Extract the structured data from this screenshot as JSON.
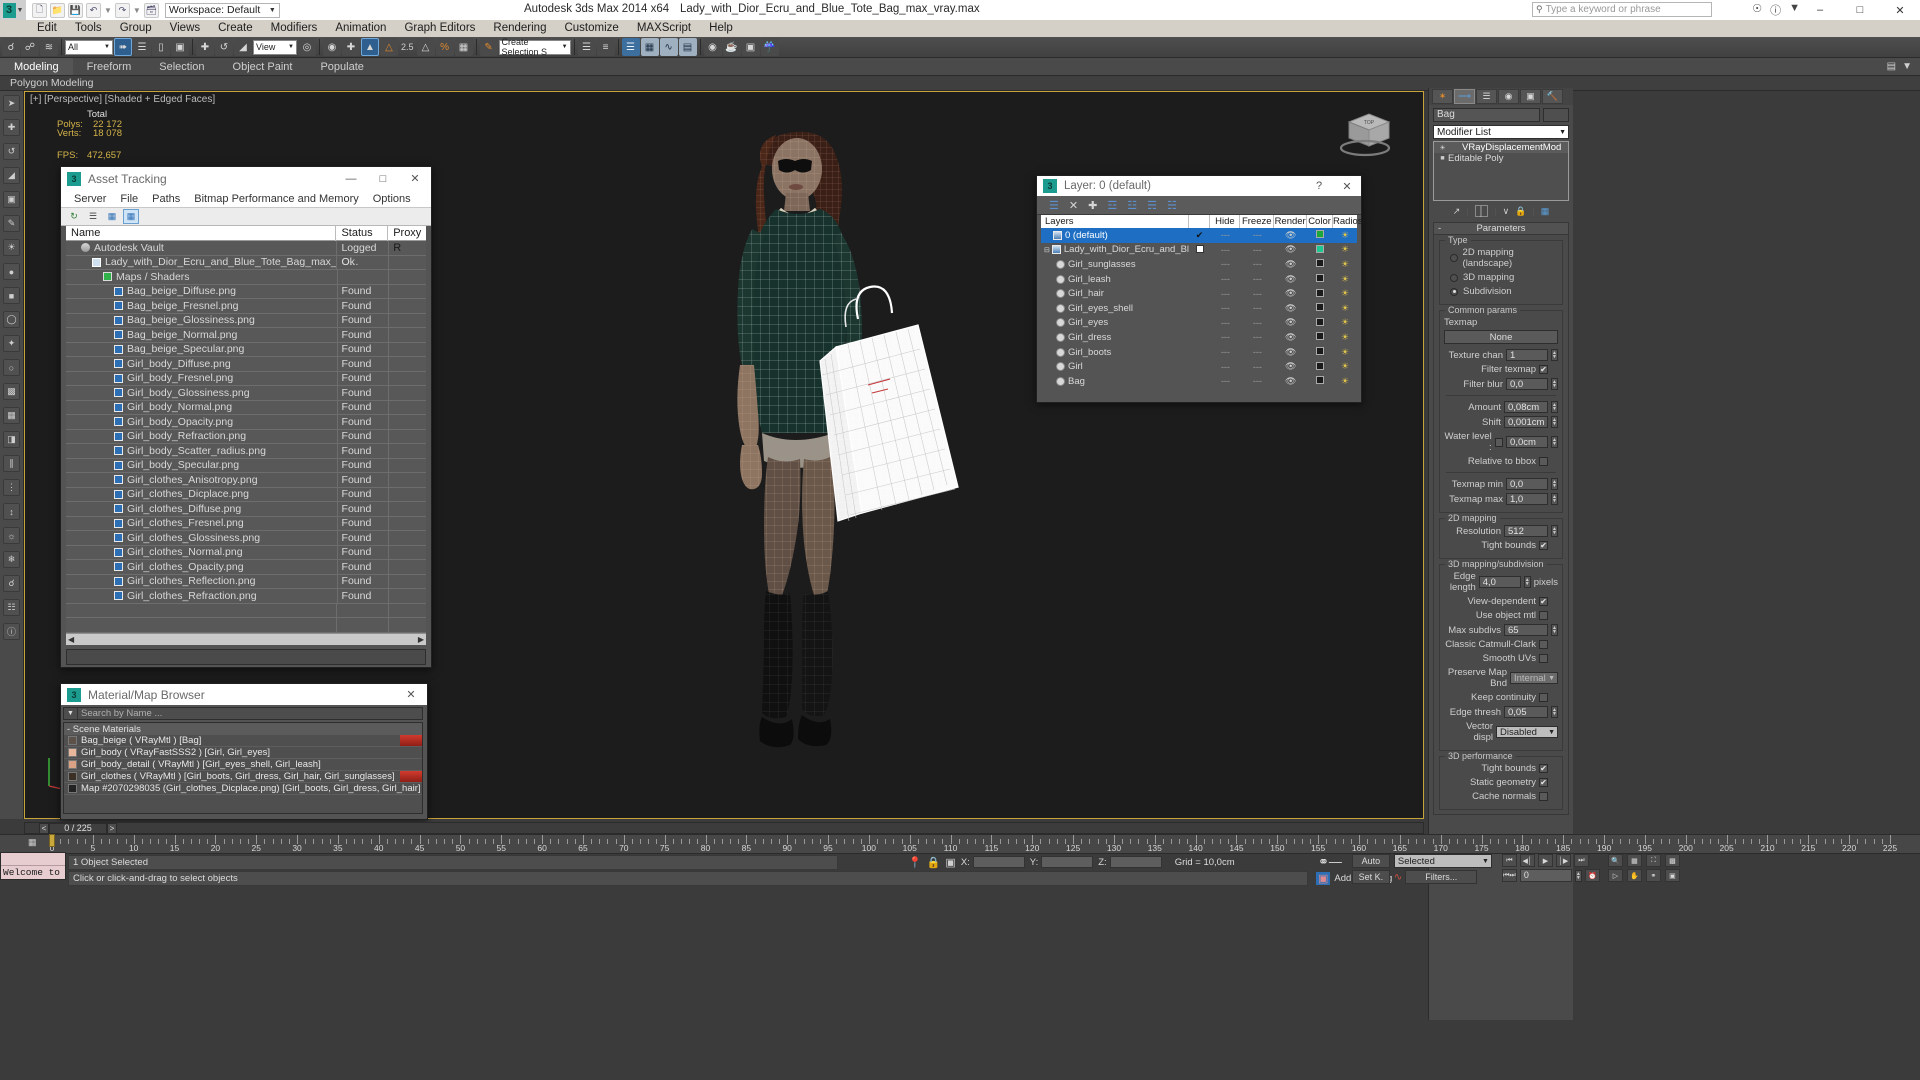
{
  "titlebar": {
    "app_icon": "max-logo-icon",
    "workspace_label": "Workspace: Default",
    "product": "Autodesk 3ds Max  2014 x64",
    "filename": "Lady_with_Dior_Ecru_and_Blue_Tote_Bag_max_vray.max",
    "search_placeholder": "Type a keyword or phrase",
    "minimize": "–",
    "maximize": "□",
    "close": "✕"
  },
  "menubar": {
    "items": [
      "Edit",
      "Tools",
      "Group",
      "Views",
      "Create",
      "Modifiers",
      "Animation",
      "Graph Editors",
      "Rendering",
      "Customize",
      "MAXScript",
      "Help"
    ]
  },
  "toolbar": {
    "selection_filter": "All",
    "reference_coord": "View",
    "angle_snap": "2.5",
    "percent_snap": "%",
    "named_selection_placeholder": "Create Selection S"
  },
  "ribbon": {
    "tabs": [
      "Modeling",
      "Freeform",
      "Selection",
      "Object Paint",
      "Populate"
    ],
    "active_tab": "Modeling",
    "subtitle": "Polygon Modeling"
  },
  "viewport": {
    "label": "[+] [Perspective] [Shaded + Edged Faces]",
    "stats_header": "Total",
    "stats": [
      {
        "key": "Polys:",
        "value": "22 172"
      },
      {
        "key": "Verts:",
        "value": "18 078"
      }
    ],
    "fps_key": "FPS:",
    "fps_value": "472,657",
    "viewcube_label": "TOP"
  },
  "asset_tracking": {
    "title": "Asset Tracking",
    "menu": [
      "Server",
      "File",
      "Paths",
      "Bitmap Performance and Memory",
      "Options"
    ],
    "toolbar_buttons": [
      "refresh-icon",
      "list-icon",
      "tree-icon",
      "grid-icon"
    ],
    "active_toolbar_button": "grid-icon",
    "columns": [
      "Name",
      "Status",
      "Proxy R"
    ],
    "rows": [
      {
        "indent": 1,
        "icon": "vault-icon",
        "name": "Autodesk Vault",
        "status": "Logged O..."
      },
      {
        "indent": 2,
        "icon": "max-file-icon",
        "name": "Lady_with_Dior_Ecru_and_Blue_Tote_Bag_max_vray.max",
        "status": "Ok"
      },
      {
        "indent": 3,
        "icon": "maps-icon",
        "name": "Maps / Shaders",
        "status": ""
      },
      {
        "indent": 4,
        "icon": "png-icon",
        "name": "Bag_beige_Diffuse.png",
        "status": "Found"
      },
      {
        "indent": 4,
        "icon": "png-icon",
        "name": "Bag_beige_Fresnel.png",
        "status": "Found"
      },
      {
        "indent": 4,
        "icon": "png-icon",
        "name": "Bag_beige_Glossiness.png",
        "status": "Found"
      },
      {
        "indent": 4,
        "icon": "png-icon",
        "name": "Bag_beige_Normal.png",
        "status": "Found"
      },
      {
        "indent": 4,
        "icon": "png-icon",
        "name": "Bag_beige_Specular.png",
        "status": "Found"
      },
      {
        "indent": 4,
        "icon": "png-icon",
        "name": "Girl_body_Diffuse.png",
        "status": "Found"
      },
      {
        "indent": 4,
        "icon": "png-icon",
        "name": "Girl_body_Fresnel.png",
        "status": "Found"
      },
      {
        "indent": 4,
        "icon": "png-icon",
        "name": "Girl_body_Glossiness.png",
        "status": "Found"
      },
      {
        "indent": 4,
        "icon": "png-icon",
        "name": "Girl_body_Normal.png",
        "status": "Found"
      },
      {
        "indent": 4,
        "icon": "png-icon",
        "name": "Girl_body_Opacity.png",
        "status": "Found"
      },
      {
        "indent": 4,
        "icon": "png-icon",
        "name": "Girl_body_Refraction.png",
        "status": "Found"
      },
      {
        "indent": 4,
        "icon": "png-icon",
        "name": "Girl_body_Scatter_radius.png",
        "status": "Found"
      },
      {
        "indent": 4,
        "icon": "png-icon",
        "name": "Girl_body_Specular.png",
        "status": "Found"
      },
      {
        "indent": 4,
        "icon": "png-icon",
        "name": "Girl_clothes_Anisotropy.png",
        "status": "Found"
      },
      {
        "indent": 4,
        "icon": "png-icon",
        "name": "Girl_clothes_Dicplace.png",
        "status": "Found"
      },
      {
        "indent": 4,
        "icon": "png-icon",
        "name": "Girl_clothes_Diffuse.png",
        "status": "Found"
      },
      {
        "indent": 4,
        "icon": "png-icon",
        "name": "Girl_clothes_Fresnel.png",
        "status": "Found"
      },
      {
        "indent": 4,
        "icon": "png-icon",
        "name": "Girl_clothes_Glossiness.png",
        "status": "Found"
      },
      {
        "indent": 4,
        "icon": "png-icon",
        "name": "Girl_clothes_Normal.png",
        "status": "Found"
      },
      {
        "indent": 4,
        "icon": "png-icon",
        "name": "Girl_clothes_Opacity.png",
        "status": "Found"
      },
      {
        "indent": 4,
        "icon": "png-icon",
        "name": "Girl_clothes_Reflection.png",
        "status": "Found"
      },
      {
        "indent": 4,
        "icon": "png-icon",
        "name": "Girl_clothes_Refraction.png",
        "status": "Found"
      },
      {
        "indent": 0,
        "icon": "",
        "name": "",
        "status": ""
      },
      {
        "indent": 0,
        "icon": "",
        "name": "",
        "status": ""
      }
    ]
  },
  "material_browser": {
    "title": "Material/Map Browser",
    "close": "✕",
    "search_placeholder": "Search by Name ...",
    "group_label": "- Scene Materials",
    "items": [
      {
        "swatch": "#5d5249",
        "name": "Bag_beige  ( VRayMtl )  [Bag]",
        "has_red_tab": true
      },
      {
        "swatch": "#e8b79b",
        "name": "Girl_body  ( VRayFastSSS2 )  [Girl, Girl_eyes]",
        "has_red_tab": false
      },
      {
        "swatch": "#d9a284",
        "name": "Girl_body_detail  ( VRayMtl )  [Girl_eyes_shell, Girl_leash]",
        "has_red_tab": false
      },
      {
        "swatch": "#3a3026",
        "name": "Girl_clothes  ( VRayMtl ) [Girl_boots, Girl_dress, Girl_hair, Girl_sunglasses]",
        "has_red_tab": true
      },
      {
        "swatch": "#232323",
        "name": "Map #2070298035 (Girl_clothes_Dicplace.png)  [Girl_boots, Girl_dress, Girl_hair]",
        "has_red_tab": false
      }
    ]
  },
  "layer_window": {
    "title": "Layer: 0 (default)",
    "help": "?",
    "close": "✕",
    "toolbar_buttons": [
      "create-new-layer-icon",
      "delete-layer-icon",
      "add-selection-icon",
      "select-objects-icon",
      "select-highlighted-icon",
      "highlight-selected-icon",
      "hide-unhide-icon"
    ],
    "columns": [
      "Layers",
      "",
      "Hide",
      "Freeze",
      "Render",
      "Color",
      "Radiosity"
    ],
    "rows": [
      {
        "indent": 0,
        "expander": "",
        "icon": "layer-icon",
        "name": "0 (default)",
        "selected": true,
        "check": "✔",
        "hide": "---",
        "freeze": "---",
        "render": "eye",
        "color": "#1aa83c",
        "radiosity": "bulb"
      },
      {
        "indent": 0,
        "expander": "⊟",
        "icon": "layer-icon",
        "name": "Lady_with_Dior_Ecru_and_Blue_Tote_Bag",
        "selected": false,
        "check": "box",
        "hide": "---",
        "freeze": "---",
        "render": "eye",
        "color": "#1fc98f",
        "radiosity": "bulb"
      },
      {
        "indent": 1,
        "expander": "",
        "icon": "object-icon",
        "name": "Girl_sunglasses",
        "selected": false,
        "check": "",
        "hide": "---",
        "freeze": "---",
        "render": "eye",
        "color": "#1b1b1b",
        "radiosity": "bulb"
      },
      {
        "indent": 1,
        "expander": "",
        "icon": "object-icon",
        "name": "Girl_leash",
        "selected": false,
        "check": "",
        "hide": "---",
        "freeze": "---",
        "render": "eye",
        "color": "#1b1b1b",
        "radiosity": "bulb"
      },
      {
        "indent": 1,
        "expander": "",
        "icon": "object-icon",
        "name": "Girl_hair",
        "selected": false,
        "check": "",
        "hide": "---",
        "freeze": "---",
        "render": "eye",
        "color": "#1b1b1b",
        "radiosity": "bulb"
      },
      {
        "indent": 1,
        "expander": "",
        "icon": "object-icon",
        "name": "Girl_eyes_shell",
        "selected": false,
        "check": "",
        "hide": "---",
        "freeze": "---",
        "render": "eye",
        "color": "#1b1b1b",
        "radiosity": "bulb"
      },
      {
        "indent": 1,
        "expander": "",
        "icon": "object-icon",
        "name": "Girl_eyes",
        "selected": false,
        "check": "",
        "hide": "---",
        "freeze": "---",
        "render": "eye",
        "color": "#1b1b1b",
        "radiosity": "bulb"
      },
      {
        "indent": 1,
        "expander": "",
        "icon": "object-icon",
        "name": "Girl_dress",
        "selected": false,
        "check": "",
        "hide": "---",
        "freeze": "---",
        "render": "eye",
        "color": "#1b1b1b",
        "radiosity": "bulb"
      },
      {
        "indent": 1,
        "expander": "",
        "icon": "object-icon",
        "name": "Girl_boots",
        "selected": false,
        "check": "",
        "hide": "---",
        "freeze": "---",
        "render": "eye",
        "color": "#1b1b1b",
        "radiosity": "bulb"
      },
      {
        "indent": 1,
        "expander": "",
        "icon": "object-icon",
        "name": "Girl",
        "selected": false,
        "check": "",
        "hide": "---",
        "freeze": "---",
        "render": "eye",
        "color": "#1b1b1b",
        "radiosity": "bulb"
      },
      {
        "indent": 1,
        "expander": "",
        "icon": "object-icon",
        "name": "Bag",
        "selected": false,
        "check": "",
        "hide": "---",
        "freeze": "---",
        "render": "eye",
        "color": "#1b1b1b",
        "radiosity": "bulb"
      }
    ]
  },
  "command_panel": {
    "tabs": [
      "create-tab",
      "modify-tab",
      "hierarchy-tab",
      "motion-tab",
      "display-tab",
      "utilities-tab"
    ],
    "active_tab": "modify-tab",
    "object_name": "Bag",
    "modifier_list_label": "Modifier List",
    "stack": [
      {
        "name": "VRayDisplacementMod",
        "selected": true
      },
      {
        "name": "Editable Poly",
        "selected": false
      }
    ],
    "parameters": {
      "rollout_title": "Parameters",
      "type_group": "Type",
      "type_options": [
        {
          "label": "2D mapping (landscape)",
          "selected": false
        },
        {
          "label": "3D mapping",
          "selected": false
        },
        {
          "label": "Subdivision",
          "selected": true
        }
      ],
      "common_group": "Common params",
      "texmap_label": "Texmap",
      "texmap_button": "None",
      "texture_chan_label": "Texture chan",
      "texture_chan_value": "1",
      "filter_texmap_label": "Filter texmap",
      "filter_texmap_checked": true,
      "filter_blur_label": "Filter blur",
      "filter_blur_value": "0,0",
      "amount_label": "Amount",
      "amount_value": "0,08cm",
      "shift_label": "Shift",
      "shift_value": "0,001cm",
      "water_level_label": "Water level  :",
      "water_level_checked": false,
      "water_level_value": "0,0cm",
      "relative_bbox_label": "Relative to bbox",
      "relative_bbox_checked": false,
      "texmap_min_label": "Texmap min",
      "texmap_min_value": "0,0",
      "texmap_max_label": "Texmap max",
      "texmap_max_value": "1,0",
      "mapping2d_group": "2D mapping",
      "resolution_label": "Resolution",
      "resolution_value": "512",
      "tight_bounds_label": "Tight bounds",
      "tight_bounds_checked": true,
      "mapping3d_group": "3D mapping/subdivision",
      "edge_length_label": "Edge length",
      "edge_length_value": "4,0",
      "edge_length_unit": "pixels",
      "view_dependent_label": "View-dependent",
      "view_dependent_checked": true,
      "use_object_mtl_label": "Use object mtl",
      "use_object_mtl_checked": false,
      "max_subdivs_label": "Max subdivs",
      "max_subdivs_value": "65",
      "classic_catmull_label": "Classic Catmull-Clark",
      "classic_catmull_checked": false,
      "smooth_uvs_label": "Smooth UVs",
      "smooth_uvs_checked": false,
      "preserve_map_label": "Preserve Map Bnd",
      "preserve_map_value": "Internal",
      "keep_continuity_label": "Keep continuity",
      "keep_continuity_checked": false,
      "edge_thresh_label": "Edge thresh",
      "edge_thresh_value": "0,05",
      "vector_displ_label": "Vector displ",
      "vector_displ_value": "Disabled",
      "perf_group": "3D performance",
      "perf_tight_bounds_label": "Tight bounds",
      "perf_tight_bounds_checked": true,
      "static_geometry_label": "Static geometry",
      "static_geometry_checked": true,
      "cache_normals_label": "Cache normals",
      "cache_normals_checked": false
    }
  },
  "timeline": {
    "frame_display": "0 / 225",
    "prev_arrow": "<",
    "next_arrow": ">",
    "ruler_labels": [
      0,
      5,
      10,
      15,
      20,
      25,
      30,
      35,
      40,
      45,
      50,
      55,
      60,
      65,
      70,
      75,
      80,
      85,
      90,
      95,
      100,
      105,
      110,
      115,
      120,
      125,
      130,
      135,
      140,
      145,
      150,
      155,
      160,
      165,
      170,
      175,
      180,
      185,
      190,
      195,
      200,
      205,
      210,
      215,
      220,
      225
    ],
    "ruler_max": 225
  },
  "statusbar": {
    "listener_text": "Welcome to",
    "selection_status": "1 Object Selected",
    "prompt": "Click or click-and-drag to select objects",
    "x_label": "X:",
    "x_value": "",
    "y_label": "Y:",
    "y_value": "",
    "z_label": "Z:",
    "z_value": "",
    "grid_label": "Grid = 10,0cm",
    "add_time_tag": "Add Time Tag",
    "auto_key": "Auto",
    "set_key": "Set K.",
    "key_filter_selected": "Selected",
    "filters_button": "Filters...",
    "current_frame": "0"
  }
}
